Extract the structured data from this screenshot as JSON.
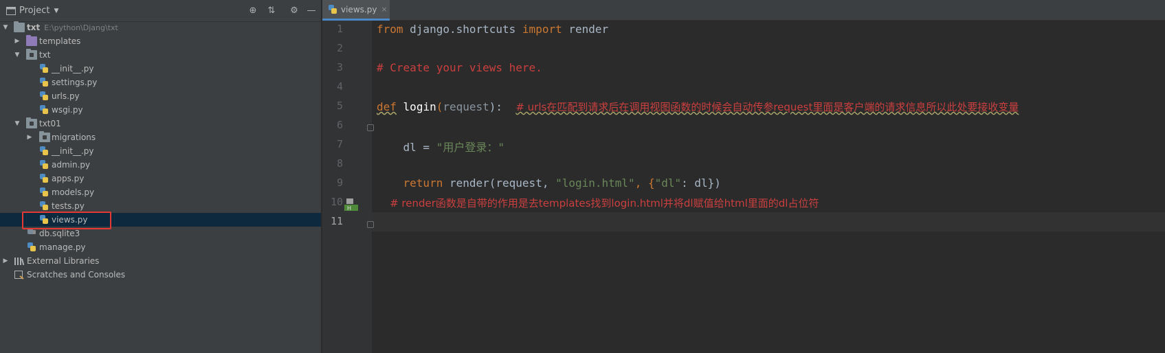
{
  "project_panel": {
    "title": "Project",
    "dropdown": "▼",
    "tools": [
      "⊕",
      "⇅",
      "⚙",
      "—"
    ]
  },
  "tree": {
    "root_label": "txt",
    "root_path": "E:\\python\\Djang\\txt",
    "items": [
      {
        "label": "templates"
      },
      {
        "label": "txt"
      },
      {
        "label": "__init__.py"
      },
      {
        "label": "settings.py"
      },
      {
        "label": "urls.py"
      },
      {
        "label": "wsgi.py"
      },
      {
        "label": "txt01"
      },
      {
        "label": "migrations"
      },
      {
        "label": "__init__.py"
      },
      {
        "label": "admin.py"
      },
      {
        "label": "apps.py"
      },
      {
        "label": "models.py"
      },
      {
        "label": "tests.py"
      },
      {
        "label": "views.py"
      },
      {
        "label": "db.sqlite3"
      },
      {
        "label": "manage.py"
      },
      {
        "label": "External Libraries"
      },
      {
        "label": "Scratches and Consoles"
      }
    ]
  },
  "editor": {
    "tab_label": "views.py",
    "tab_close": "×",
    "line_numbers": [
      "1",
      "2",
      "3",
      "4",
      "5",
      "6",
      "7",
      "8",
      "9",
      "10",
      "11"
    ],
    "code": {
      "l1_from": "from",
      "l1_mod": " django.shortcuts ",
      "l1_import": "import",
      "l1_name": " render",
      "l3_comment": "# Create your views here.",
      "l5_def": "def",
      "l5_fn": "login",
      "l5_open": "(",
      "l5_param": "request",
      "l5_close": "):  ",
      "l5_comment": "# urls在匹配到请求后在调用视图函数的时候会自动传参request里面是客户端的请求信息所以此处要接收变量",
      "l7_var": "    dl = ",
      "l7_str": "\"用户登录：\"",
      "l9_return": "    return",
      "l9_call": " render(request, ",
      "l9_str1": "\"login.html\"",
      "l9_comma": ", {",
      "l9_str2": "\"dl\"",
      "l9_rest": ": dl})",
      "l10_comment": "    # render函数是自带的作用是去templates找到login.html并将dl赋值给html里面的dl占位符"
    }
  }
}
